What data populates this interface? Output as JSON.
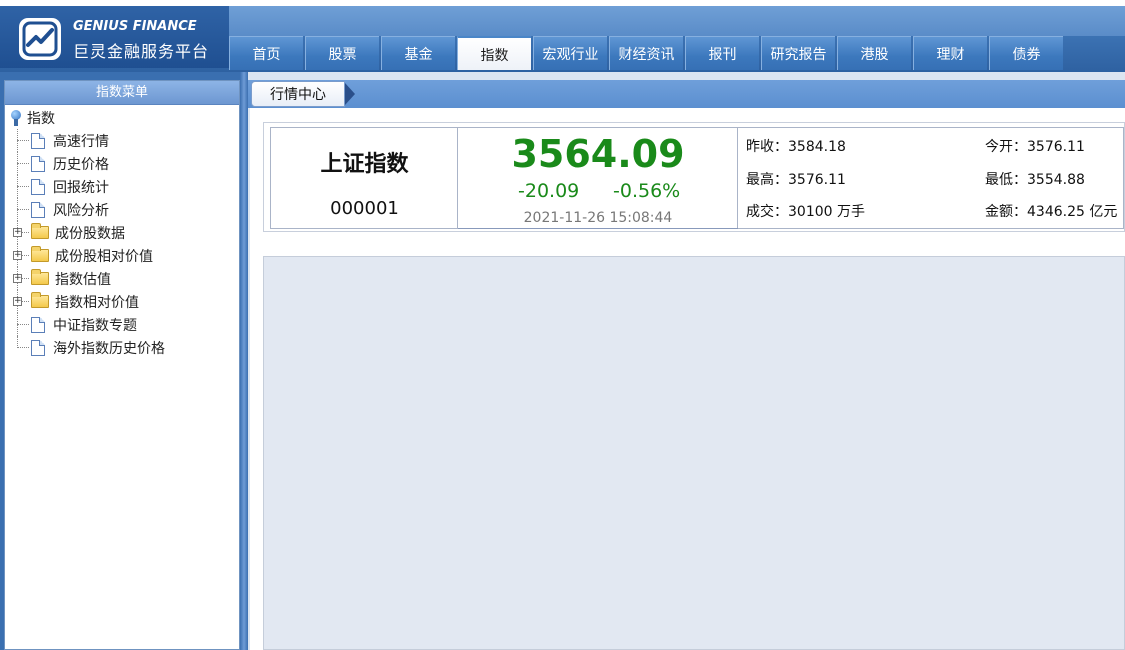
{
  "app": {
    "brand_en": "GENIUS FINANCE",
    "brand_cn": "巨灵金融服务平台"
  },
  "nav": {
    "tabs": [
      "首页",
      "股票",
      "基金",
      "指数",
      "宏观行业",
      "财经资讯",
      "报刊",
      "研究报告",
      "港股",
      "理财",
      "债券"
    ],
    "active_index": 3
  },
  "sidebar": {
    "title": "指数菜单",
    "root": "指数",
    "items": [
      {
        "label": "高速行情",
        "type": "page"
      },
      {
        "label": "历史价格",
        "type": "page"
      },
      {
        "label": "回报统计",
        "type": "page"
      },
      {
        "label": "风险分析",
        "type": "page"
      },
      {
        "label": "成份股数据",
        "type": "folder"
      },
      {
        "label": "成份股相对价值",
        "type": "folder"
      },
      {
        "label": "指数估值",
        "type": "folder"
      },
      {
        "label": "指数相对价值",
        "type": "folder"
      },
      {
        "label": "中证指数专题",
        "type": "page"
      },
      {
        "label": "海外指数历史价格",
        "type": "page"
      }
    ]
  },
  "breadcrumb": "行情中心",
  "quote": {
    "name": "上证指数",
    "code": "000001",
    "price": "3564.09",
    "change": "-20.09",
    "change_pct": "-0.56%",
    "time": "2021-11-26 15:08:44",
    "stats": {
      "prev_close": "昨收：3584.18",
      "open": "今开：3576.11",
      "high": "最高：3576.11",
      "low": "最低：3554.88",
      "volume": "成交：30100 万手",
      "amount": "金额：4346.25 亿元"
    },
    "colors": {
      "down": "#1a8a1a"
    }
  }
}
